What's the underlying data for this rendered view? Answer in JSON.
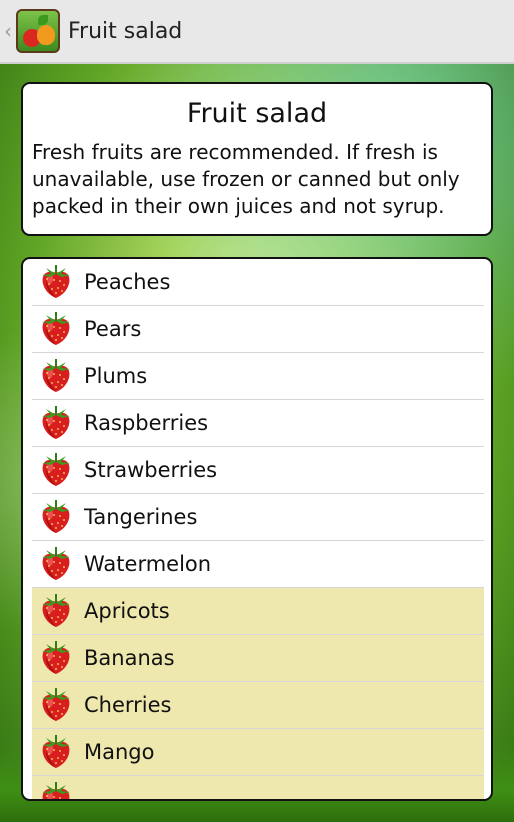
{
  "action_bar": {
    "up_caret": "‹",
    "title": "Fruit salad"
  },
  "info": {
    "title": "Fruit salad",
    "text": "Fresh fruits are recommended. If fresh is unavailable, use frozen or canned but only packed in their own juices and not syrup."
  },
  "fruits": [
    {
      "label": "Peaches",
      "highlight": false
    },
    {
      "label": "Pears",
      "highlight": false
    },
    {
      "label": "Plums",
      "highlight": false
    },
    {
      "label": "Raspberries",
      "highlight": false
    },
    {
      "label": "Strawberries",
      "highlight": false
    },
    {
      "label": "Tangerines",
      "highlight": false
    },
    {
      "label": "Watermelon",
      "highlight": false
    },
    {
      "label": "Apricots",
      "highlight": true
    },
    {
      "label": "Bananas",
      "highlight": true
    },
    {
      "label": "Cherries",
      "highlight": true
    },
    {
      "label": "Mango",
      "highlight": true
    },
    {
      "label": "",
      "highlight": true
    }
  ],
  "icons": {
    "list_item": "strawberry-icon",
    "app": "fruit-app-icon",
    "up": "back-caret-icon"
  },
  "colors": {
    "highlight_row": "#efe8ae",
    "action_bar": "#e8e8e8",
    "card_border": "#111111"
  }
}
